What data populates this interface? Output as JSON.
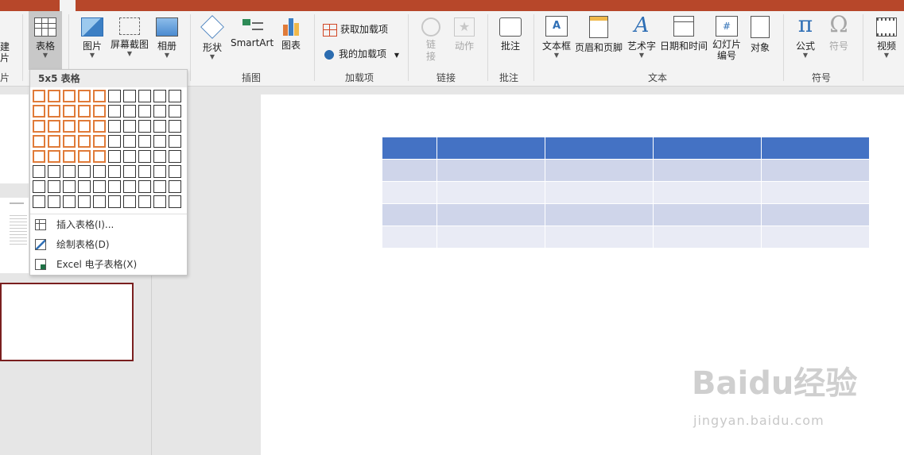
{
  "ribbon": {
    "buttons": {
      "table": "表格",
      "pictures": "图片",
      "screenshot": "屏幕截图",
      "album": "相册",
      "shapes": "形状",
      "smartart": "SmartArt",
      "chart": "图表",
      "get_addins": "获取加载项",
      "my_addins": "我的加载项",
      "link": "链接",
      "action": "动作",
      "comment": "批注",
      "textbox": "文本框",
      "header_footer": "页眉和页脚",
      "wordart": "艺术字",
      "datetime": "日期和时间",
      "slide_number": "幻灯片编号",
      "object": "对象",
      "equation": "公式",
      "symbol": "符号",
      "video": "视频"
    },
    "groups": {
      "illustrations": "插图",
      "addins": "加载项",
      "links": "链接",
      "comments": "批注",
      "text": "文本",
      "symbols": "符号",
      "partial_left": "片"
    },
    "partial_left_button": "建\n片"
  },
  "table_dropdown": {
    "title": "5x5 表格",
    "grid": {
      "cols": 10,
      "rows": 8,
      "selected_cols": 5,
      "selected_rows": 5
    },
    "menu": [
      {
        "label": "插入表格(I)...",
        "icon": "insert-table-icon"
      },
      {
        "label": "绘制表格(D)",
        "icon": "draw-table-icon"
      },
      {
        "label": "Excel 电子表格(X)",
        "icon": "excel-icon"
      }
    ]
  },
  "slide_table": {
    "rows": 5,
    "cols": 5
  },
  "colors": {
    "accent": "#b7472a",
    "table_header": "#4472c4",
    "table_band1": "#cfd5ea",
    "table_band2": "#e9ebf5",
    "hover_cell": "#e07b39"
  },
  "watermark": {
    "text": "Baidu经验",
    "sub": "jingyan.baidu.com"
  }
}
